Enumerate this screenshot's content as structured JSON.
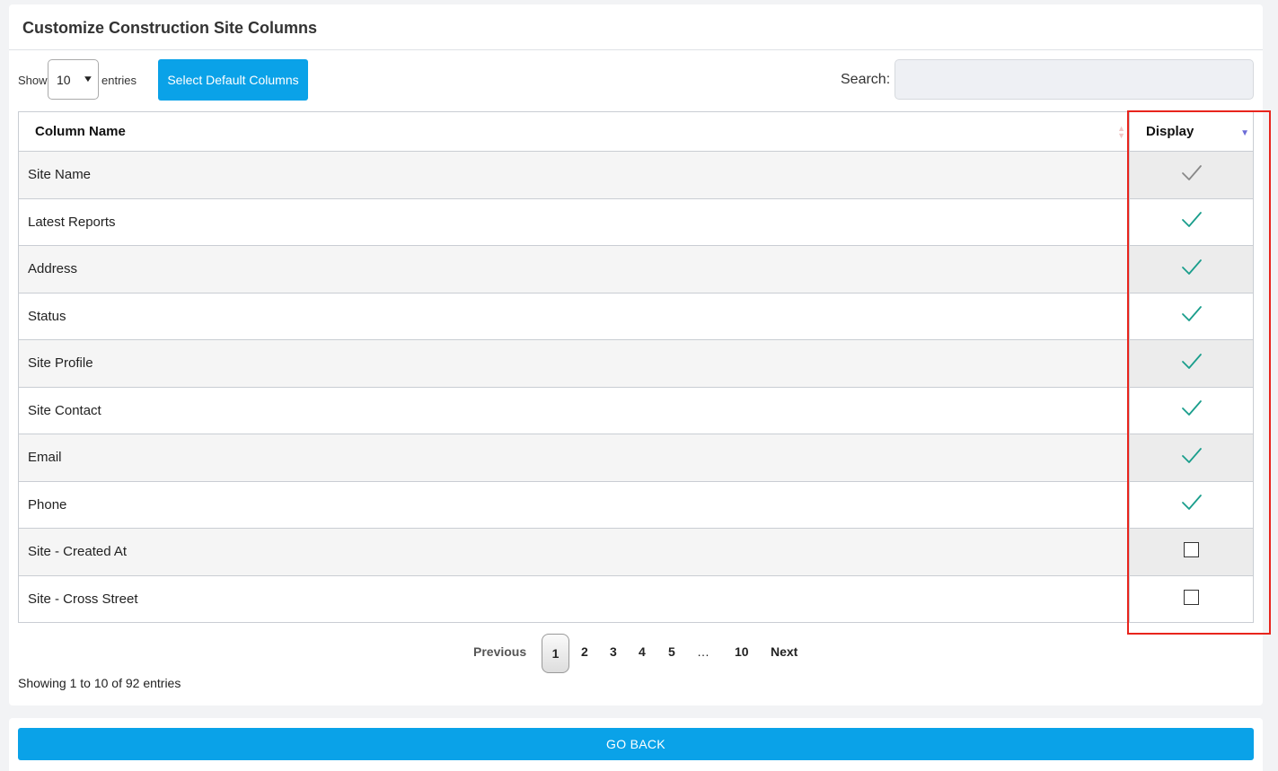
{
  "title": "Customize Construction Site Columns",
  "length_menu": {
    "show_label": "Show",
    "value": "10",
    "entries_label": "entries"
  },
  "default_button": "Select Default Columns",
  "search": {
    "label": "Search:",
    "value": ""
  },
  "table": {
    "headers": [
      "Column Name",
      "Display"
    ],
    "rows": [
      {
        "name": "Site Name",
        "display": "disabled-check"
      },
      {
        "name": "Latest Reports",
        "display": "check"
      },
      {
        "name": "Address",
        "display": "check"
      },
      {
        "name": "Status",
        "display": "check"
      },
      {
        "name": "Site Profile",
        "display": "check"
      },
      {
        "name": "Site Contact",
        "display": "check"
      },
      {
        "name": "Email",
        "display": "check"
      },
      {
        "name": "Phone",
        "display": "check"
      },
      {
        "name": "Site - Created At",
        "display": "unchecked"
      },
      {
        "name": "Site - Cross Street",
        "display": "unchecked"
      }
    ]
  },
  "pagination": {
    "previous": "Previous",
    "pages": [
      "1",
      "2",
      "3",
      "4",
      "5",
      "…",
      "10"
    ],
    "current": "1",
    "next": "Next"
  },
  "info": "Showing 1 to 10 of 92 entries",
  "go_back": "GO BACK",
  "colors": {
    "accent": "#0aa2e8",
    "check": "#1a9e8c",
    "disabled_check": "#888888",
    "highlight": "#e8241c"
  }
}
